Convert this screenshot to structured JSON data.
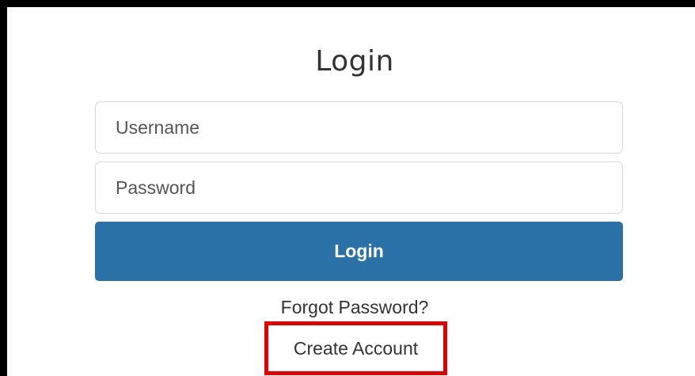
{
  "login_form": {
    "title": "Login",
    "username_placeholder": "Username",
    "password_placeholder": "Password",
    "submit_label": "Login",
    "forgot_password_label": "Forgot Password?",
    "create_account_label": "Create Account"
  },
  "colors": {
    "button": "#2a71a7",
    "highlight": "#e50000",
    "frame": "#000000"
  }
}
